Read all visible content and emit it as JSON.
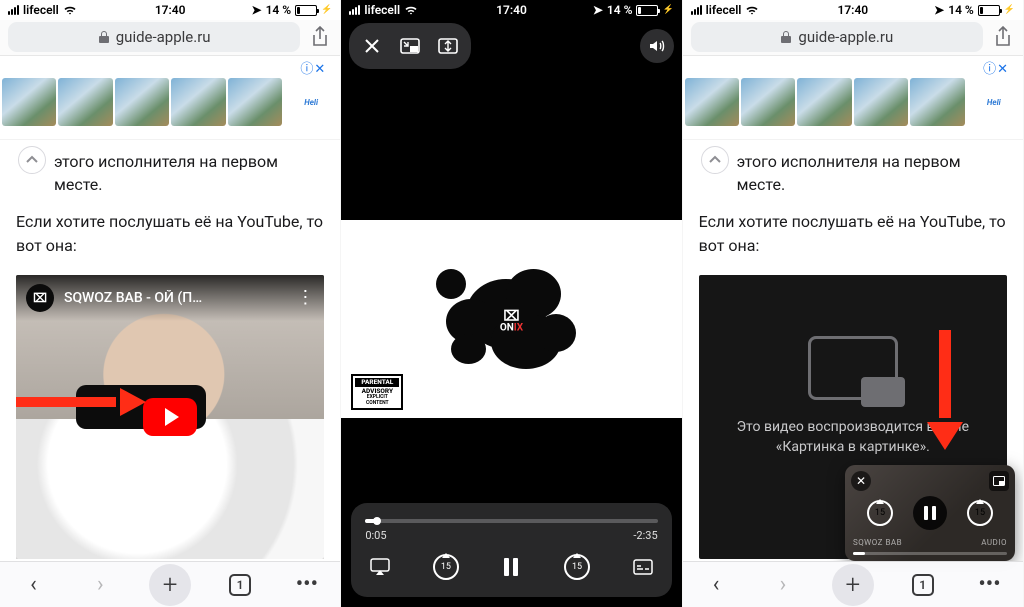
{
  "status": {
    "carrier": "lifecell",
    "time": "17:40",
    "battery_pct": "14 %",
    "loc_icon": "location-icon",
    "charge_icon": "charging-icon"
  },
  "safari": {
    "url": "guide-apple.ru",
    "toolbar": {
      "back": "‹",
      "forward": "›",
      "plus": "+",
      "tabs_count": "1",
      "more": "•••"
    }
  },
  "ad": {
    "close_label": "ⓘ✕",
    "brand": "Heli"
  },
  "article": {
    "line1": "этого исполнителя на первом месте.",
    "line2": "Если хотите послушать её на YouTube, то вот она:"
  },
  "yt": {
    "title": "SQWOZ BAB - ОЙ (П…",
    "channel_glyph": "⌧"
  },
  "player": {
    "elapsed": "0:05",
    "remaining": "-2:35",
    "skip_num": "15",
    "brand_top": "ON",
    "brand_ix": "IX",
    "parental_top": "PARENTAL",
    "parental_mid": "ADVISORY",
    "parental_bot": "EXPLICIT CONTENT"
  },
  "pip": {
    "msg": "Это видео воспроизводится в окне «Картинка в картинке».",
    "skip_num": "15",
    "label_left": "SQWOZ BAB",
    "label_right": "AUDIO"
  }
}
